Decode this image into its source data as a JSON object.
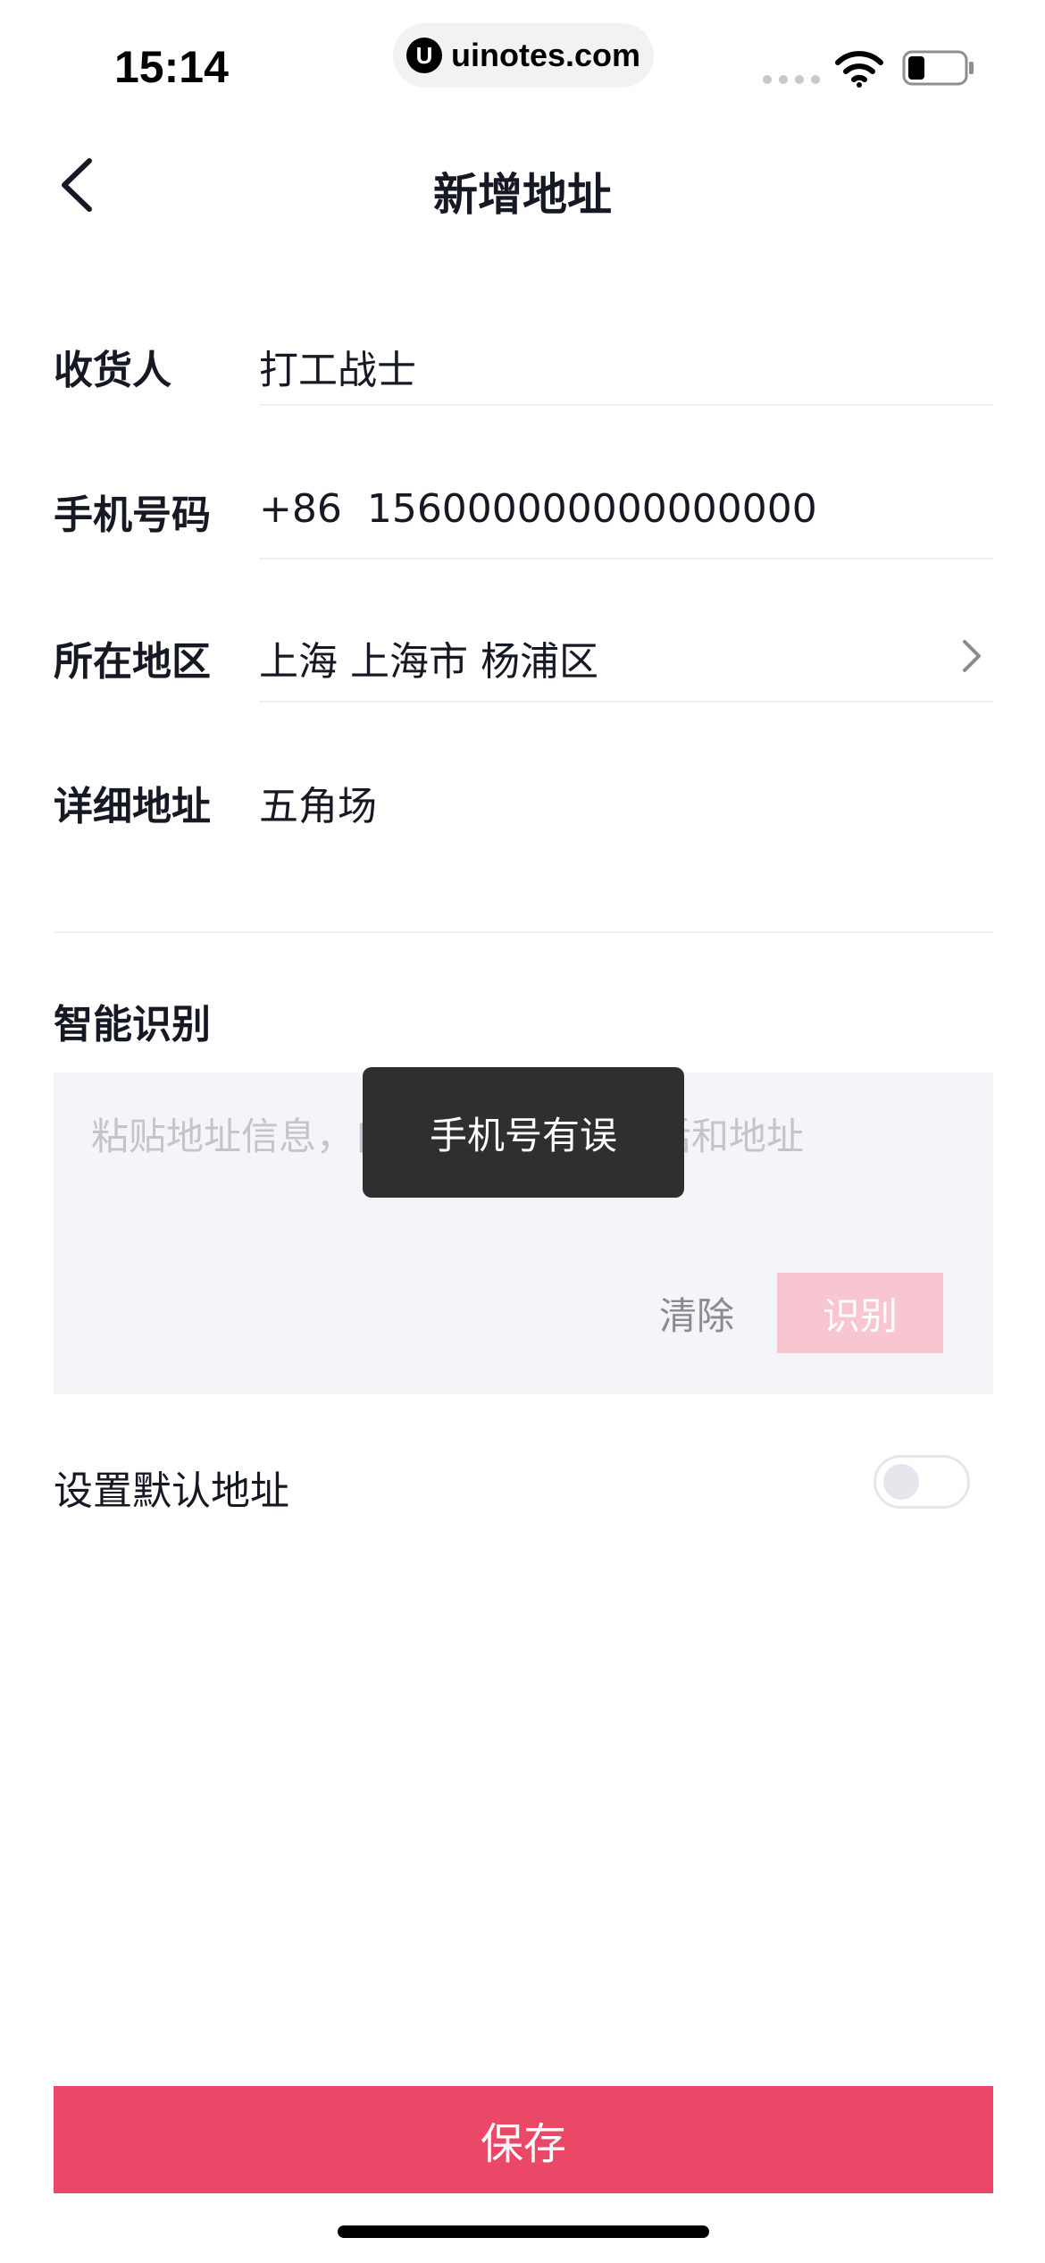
{
  "status_bar": {
    "time": "15:14",
    "url": "uinotes.com",
    "url_logo": "U"
  },
  "nav": {
    "title": "新增地址",
    "back_icon": "chevron-left-icon"
  },
  "form": {
    "recipient": {
      "label": "收货人",
      "value": "打工战士"
    },
    "phone": {
      "label": "手机号码",
      "value": "+86  156000000000000000"
    },
    "region": {
      "label": "所在地区",
      "value": "上海 上海市 杨浦区"
    },
    "detail": {
      "label": "详细地址",
      "value": "五角场"
    }
  },
  "smart_recognition": {
    "title": "智能识别",
    "placeholder": "粘贴地址信息，自动识别姓名、电话和地址",
    "clear_label": "清除",
    "recognize_label": "识别"
  },
  "toast": {
    "message": "手机号有误"
  },
  "default_address": {
    "label": "设置默认地址",
    "enabled": false
  },
  "save_label": "保存",
  "colors": {
    "accent": "#ea4866",
    "accent_disabled": "#f7c6d1",
    "toast_bg": "#2f2f30"
  }
}
